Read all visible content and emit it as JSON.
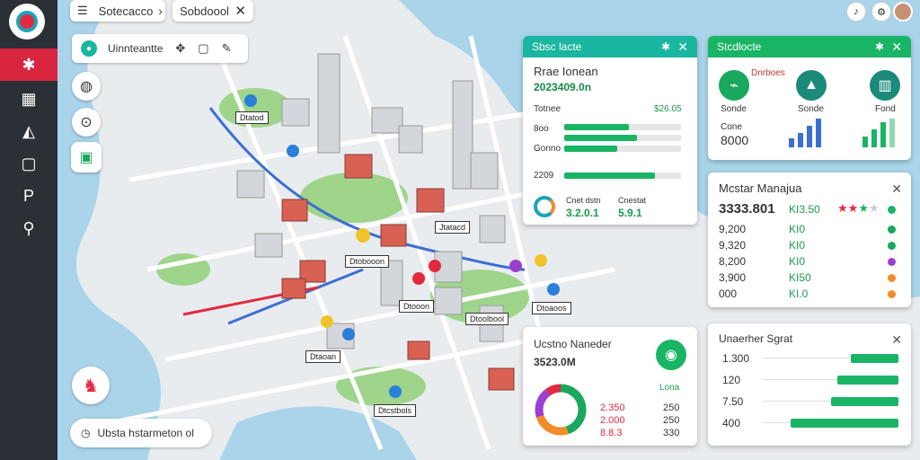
{
  "toolbar": {
    "search_label": "Sotecacco",
    "selected_label": "Sobdoool",
    "layers_label": "Uinnteantte"
  },
  "map_labels": [
    "Dtatod",
    "Jtatacd",
    "Dtobooon",
    "Dtooon",
    "Dtoolbool",
    "Dtoaoos",
    "Dtaoan",
    "Dtcstbols"
  ],
  "search_bottom": "Ubsta hstarmeton ol",
  "panel_traffic": {
    "tab": "Sbsc lacte",
    "title": "Rrae Ionean",
    "value": "2023409.0n",
    "rows": [
      {
        "label": "Totnee",
        "value": "$26.05"
      },
      {
        "label": "8oo",
        "value": ""
      },
      {
        "label": "Gonno",
        "value": ""
      },
      {
        "label": "2209",
        "value": ""
      }
    ],
    "progress": [
      0.55,
      0.62,
      0.45,
      0.78
    ],
    "footer_left_label": "Cnet dstn",
    "footer_left_value": "3.2.0.1",
    "footer_right_label": "Cnestat",
    "footer_right_value": "5.9.1"
  },
  "panel_stats": {
    "tab": "Stcdlocte",
    "heading": "Dnrboes",
    "icons": [
      {
        "label": "Sonde",
        "color": "#19a85d"
      },
      {
        "label": "Sonde",
        "color": "#1b8a7a"
      },
      {
        "label": "Fond",
        "color": "#1b8a7a"
      }
    ],
    "row_label": "Cone",
    "row_value": "8000"
  },
  "panel_market": {
    "title": "Mcstar Manajua",
    "value": "3333.801",
    "unit": "KI3.50",
    "rows": [
      {
        "a": "9,200",
        "b": "KI0",
        "color": "#19a85d"
      },
      {
        "a": "9,320",
        "b": "KI0",
        "color": "#19a85d"
      },
      {
        "a": "8,200",
        "b": "KI0",
        "color": "#9b3fd1"
      },
      {
        "a": "3,900",
        "b": "KI50",
        "color": "#f28b2a"
      },
      {
        "a": "000",
        "b": "KI.0",
        "color": "#f28b2a"
      }
    ],
    "stars": 3
  },
  "panel_volume": {
    "title": "Ucstno Naneder",
    "value": "3523.0M",
    "badge": "Lona",
    "rows": [
      {
        "a": "2.350",
        "b": "250"
      },
      {
        "a": "2.000",
        "b": "250"
      },
      {
        "a": "8.8.3",
        "b": "330"
      }
    ],
    "donut": [
      0.45,
      0.25,
      0.2,
      0.1
    ],
    "donut_colors": [
      "#19a85d",
      "#f28b2a",
      "#9b3fd1",
      "#e2293f"
    ]
  },
  "panel_speed": {
    "title": "Unaerher Sgrat",
    "rows": [
      {
        "label": "1.300",
        "fill": 0.35
      },
      {
        "label": "120",
        "fill": 0.45
      },
      {
        "label": "7.50",
        "fill": 0.5
      },
      {
        "label": "400",
        "fill": 0.8
      }
    ]
  },
  "colors": {
    "accent": "#1ab6a0",
    "green": "#19b465",
    "rail": "#2b2f36",
    "active": "#d9263f"
  }
}
